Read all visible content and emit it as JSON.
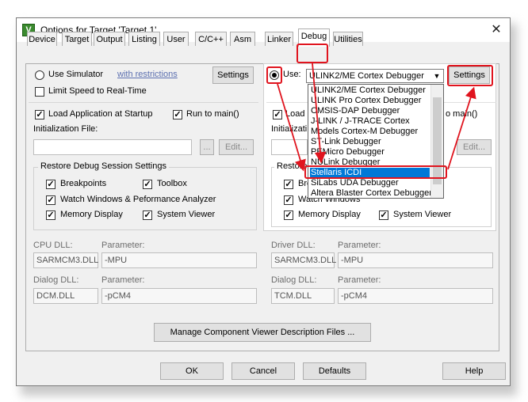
{
  "window": {
    "title": "Options for Target 'Target 1'"
  },
  "tabs": [
    {
      "label": "Device"
    },
    {
      "label": "Target"
    },
    {
      "label": "Output"
    },
    {
      "label": "Listing"
    },
    {
      "label": "User"
    },
    {
      "label": "C/C++"
    },
    {
      "label": "Asm"
    },
    {
      "label": "Linker"
    },
    {
      "label": "Debug"
    },
    {
      "label": "Utilities"
    }
  ],
  "left": {
    "use_simulator": "Use Simulator",
    "with_restrictions": "with restrictions",
    "settings_label": "Settings",
    "limit_speed": "Limit Speed to Real-Time",
    "load_app": "Load Application at Startup",
    "run_to_main": "Run to main()",
    "init_file_label": "Initialization File:",
    "browse_label": "...",
    "edit_label": "Edit...",
    "restore_group": "Restore Debug Session Settings",
    "breakpoints": "Breakpoints",
    "toolbox": "Toolbox",
    "watch_windows": "Watch Windows & Peformance Analyzer",
    "memory_display": "Memory Display",
    "system_viewer": "System Viewer",
    "cpu_dll_label": "CPU DLL:",
    "cpu_param_label": "Parameter:",
    "cpu_dll": "SARMCM3.DLL",
    "cpu_param": "-MPU",
    "dialog_dll_label": "Dialog DLL:",
    "dialog_param_label": "Parameter:",
    "dialog_dll": "DCM.DLL",
    "dialog_param": "-pCM4"
  },
  "right": {
    "use_label": "Use:",
    "debugger_selected": "ULINK2/ME Cortex Debugger",
    "settings_label": "Settings",
    "load_label": "Load",
    "run_main_partial": "o main()",
    "init_partial": "Initializati",
    "edit_label": "Edit...",
    "restore_partial": "Restore",
    "breakpoints_partial": "Bre",
    "watch_partial": "Watch Windows",
    "memory_display": "Memory Display",
    "system_viewer": "System Viewer",
    "driver_dll_label": "Driver DLL:",
    "driver_param_label": "Parameter:",
    "driver_dll": "SARMCM3.DLL",
    "driver_param": "-MPU",
    "dialog_dll_label": "Dialog DLL:",
    "dialog_param_label": "Parameter:",
    "dialog_dll": "TCM.DLL",
    "dialog_param": "-pCM4"
  },
  "debugger_options": [
    "ULINK2/ME Cortex Debugger",
    "ULINK Pro Cortex Debugger",
    "CMSIS-DAP Debugger",
    "J-LINK / J-TRACE Cortex",
    "Models Cortex-M Debugger",
    "ST-Link Debugger",
    "PEMicro Debugger",
    "NULink Debugger",
    "Stellaris ICDI",
    "SiLabs UDA Debugger",
    "Altera Blaster Cortex Debugger"
  ],
  "selected_debugger": "Stellaris ICDI",
  "manage_button": "Manage Component Viewer Description Files ...",
  "footer": {
    "ok": "OK",
    "cancel": "Cancel",
    "defaults": "Defaults",
    "help": "Help"
  },
  "annotation_color": "#e0141e"
}
